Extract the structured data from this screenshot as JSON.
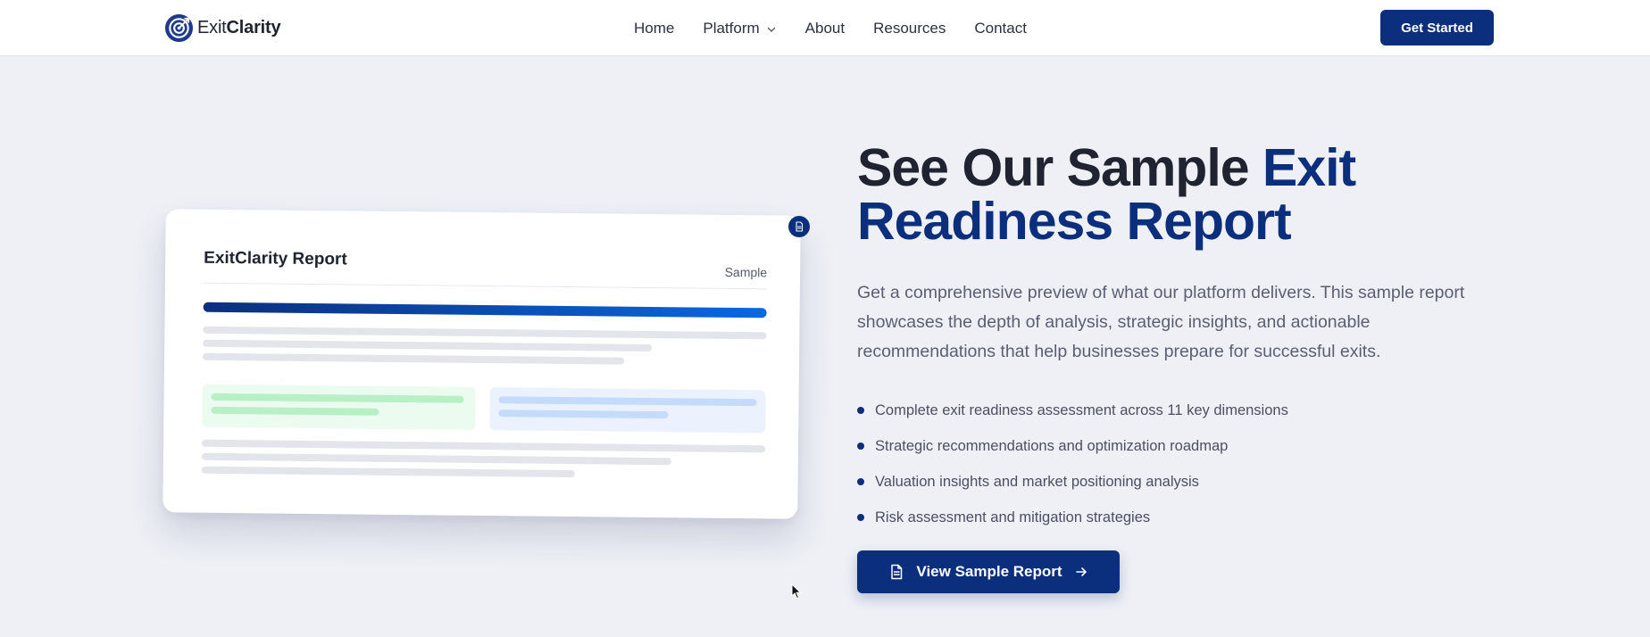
{
  "nav": {
    "logo": {
      "light": "Exit",
      "bold": "Clarity",
      "icon": "target-logo-icon"
    },
    "links": [
      {
        "label": "Home"
      },
      {
        "label": "Platform",
        "has_dropdown": true
      },
      {
        "label": "About"
      },
      {
        "label": "Resources"
      },
      {
        "label": "Contact"
      }
    ],
    "cta_label": "Get Started"
  },
  "report_preview": {
    "title": "ExitClarity Report",
    "tag": "Sample",
    "badge_icon": "document-icon"
  },
  "hero": {
    "headline_dark": "See Our Sample ",
    "headline_accent": "Exit Readiness Report",
    "description": "Get a comprehensive preview of what our platform delivers. This sample report showcases the depth of analysis, strategic insights, and actionable recommendations that help businesses prepare for successful exits.",
    "features": [
      "Complete exit readiness assessment across 11 key dimensions",
      "Strategic recommendations and optimization roadmap",
      "Valuation insights and market positioning analysis",
      "Risk assessment and mitigation strategies"
    ],
    "cta_label": "View Sample Report"
  },
  "colors": {
    "brand": "#0b2f7d",
    "gradient_end": "#0a68e0",
    "background": "#eef0f6"
  }
}
